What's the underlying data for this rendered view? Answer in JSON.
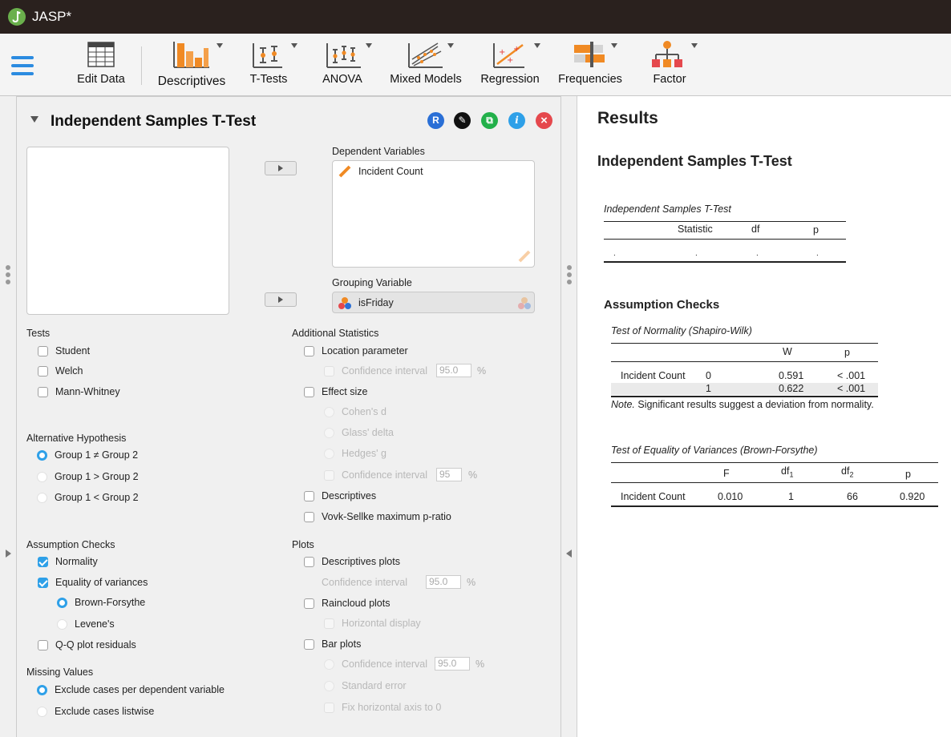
{
  "window": {
    "title": "JASP*"
  },
  "ribbon": {
    "items": [
      {
        "label": "Edit Data",
        "icon": "table-icon"
      },
      {
        "label": "Descriptives",
        "icon": "bar-chart-icon"
      },
      {
        "label": "T-Tests",
        "icon": "ttest-icon"
      },
      {
        "label": "ANOVA",
        "icon": "anova-icon"
      },
      {
        "label": "Mixed Models",
        "icon": "mixed-models-icon"
      },
      {
        "label": "Regression",
        "icon": "regression-icon"
      },
      {
        "label": "Frequencies",
        "icon": "frequencies-icon"
      },
      {
        "label": "Factor",
        "icon": "factor-icon"
      }
    ]
  },
  "analysis": {
    "title": "Independent Samples T-Test",
    "header_buttons": [
      {
        "name": "r-syntax",
        "label": "R",
        "color": "#2a6fd6"
      },
      {
        "name": "edit",
        "label": "✎",
        "color": "#111111"
      },
      {
        "name": "duplicate",
        "label": "⧉",
        "color": "#22b04a"
      },
      {
        "name": "info",
        "label": "i",
        "color": "#2ea0e8"
      },
      {
        "name": "close",
        "label": "×",
        "color": "#e5484d"
      }
    ],
    "dependent_label": "Dependent Variables",
    "dependent_value": "Incident Count",
    "grouping_label": "Grouping Variable",
    "grouping_value": "isFriday",
    "tests": {
      "label": "Tests",
      "student": "Student",
      "welch": "Welch",
      "mann_whitney": "Mann-Whitney"
    },
    "additional": {
      "label": "Additional Statistics",
      "location": "Location parameter",
      "ci": "Confidence interval",
      "ci_value": "95.0",
      "pct": "%",
      "effect_size": "Effect size",
      "cohens_d": "Cohen's d",
      "glass": "Glass' delta",
      "hedges": "Hedges' g",
      "es_ci": "Confidence interval",
      "es_ci_value": "95",
      "descriptives": "Descriptives",
      "vovk": "Vovk-Sellke maximum p-ratio"
    },
    "alt_hypothesis": {
      "label": "Alternative Hypothesis",
      "ne": "Group 1 ≠ Group 2",
      "gt": "Group 1 > Group 2",
      "lt": "Group 1 < Group 2"
    },
    "assumption": {
      "label": "Assumption Checks",
      "normality": "Normality",
      "equality": "Equality of variances",
      "brown_forsythe": "Brown-Forsythe",
      "levene": "Levene's",
      "qq": "Q-Q plot residuals"
    },
    "plots": {
      "label": "Plots",
      "desc_plots": "Descriptives plots",
      "ci": "Confidence interval",
      "ci_value": "95.0",
      "raincloud": "Raincloud plots",
      "horizontal": "Horizontal display",
      "bar": "Bar plots",
      "bar_ci": "Confidence interval",
      "bar_ci_value": "95.0",
      "se": "Standard error",
      "fix_axis": "Fix horizontal axis to 0"
    },
    "missing": {
      "label": "Missing Values",
      "per_dv": "Exclude cases per dependent variable",
      "listwise": "Exclude cases listwise"
    }
  },
  "results": {
    "title": "Results",
    "analysis_title": "Independent Samples T-Test",
    "ttest_table": {
      "caption": "Independent Samples T-Test",
      "headers": [
        "Statistic",
        "df",
        "p"
      ],
      "row": [
        ".",
        ".",
        ".",
        "."
      ]
    },
    "assumption_heading": "Assumption Checks",
    "normality": {
      "caption": "Test of Normality (Shapiro-Wilk)",
      "headers": [
        "W",
        "p"
      ],
      "variable": "Incident Count",
      "rows": [
        {
          "group": "0",
          "W": "0.591",
          "p": "< .001"
        },
        {
          "group": "1",
          "W": "0.622",
          "p": "< .001"
        }
      ],
      "note_label": "Note.",
      "note_text": " Significant results suggest a deviation from normality."
    },
    "equality": {
      "caption": "Test of Equality of Variances (Brown-Forsythe)",
      "headers": [
        "F",
        "df",
        "1",
        "df",
        "2",
        "p"
      ],
      "variable": "Incident Count",
      "F": "0.010",
      "df1": "1",
      "df2": "66",
      "p": "0.920"
    }
  }
}
